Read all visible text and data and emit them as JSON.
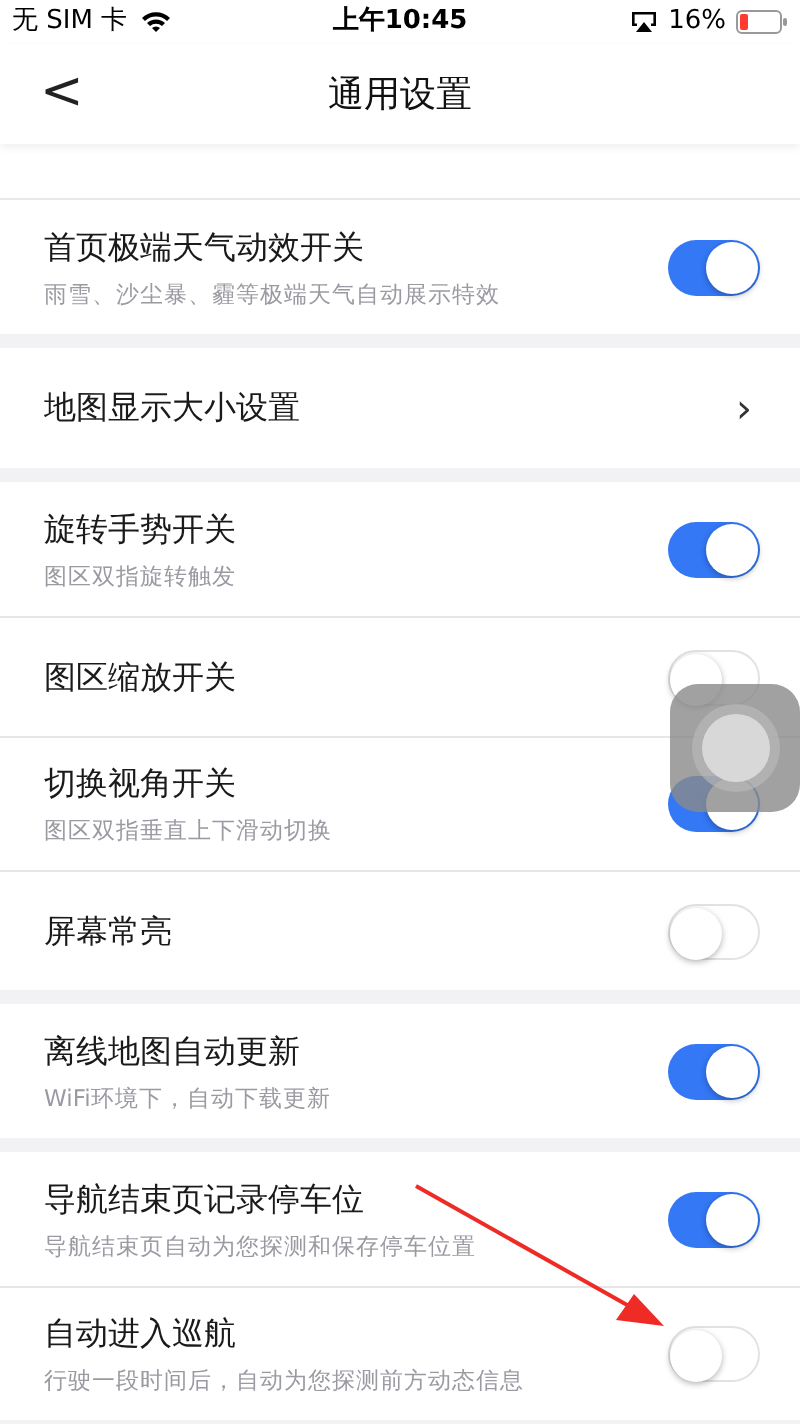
{
  "status_bar": {
    "carrier": "无 SIM 卡",
    "time": "上午10:45",
    "battery": "16%"
  },
  "nav_bar": {
    "back": "<",
    "title": "通用设置"
  },
  "groups": [
    [
      {
        "kind": "toggle",
        "title": "首页极端天气动效开关",
        "subtitle": "雨雪、沙尘暴、霾等极端天气自动展示特效",
        "on": true
      }
    ],
    [
      {
        "kind": "link",
        "title": "地图显示大小设置",
        "chevron": "›"
      }
    ],
    [
      {
        "kind": "toggle",
        "title": "旋转手势开关",
        "subtitle": "图区双指旋转触发",
        "on": true
      },
      {
        "kind": "toggle",
        "title": "图区缩放开关",
        "on": false
      },
      {
        "kind": "toggle",
        "title": "切换视角开关",
        "subtitle": "图区双指垂直上下滑动切换",
        "on": true
      },
      {
        "kind": "toggle",
        "title": "屏幕常亮",
        "on": false
      }
    ],
    [
      {
        "kind": "toggle",
        "title": "离线地图自动更新",
        "subtitle": "WiFi环境下，自动下载更新",
        "on": true
      }
    ],
    [
      {
        "kind": "toggle",
        "title": "导航结束页记录停车位",
        "subtitle": "导航结束页自动为您探测和保存停车位置",
        "on": true
      },
      {
        "kind": "toggle",
        "title": "自动进入巡航",
        "subtitle": "行驶一段时间后，自动为您探测前方动态信息",
        "on": false
      }
    ]
  ]
}
